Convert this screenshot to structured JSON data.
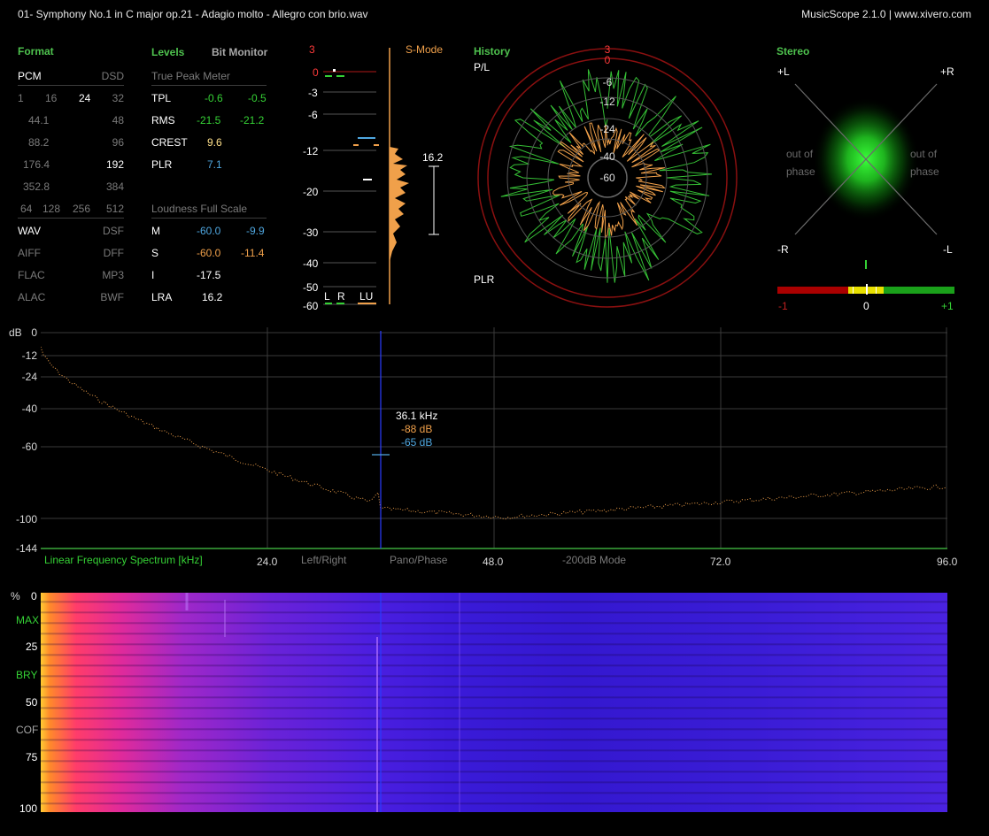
{
  "window": {
    "title": "01- Symphony No.1 in C major op.21 - Adagio molto - Allegro con brio.wav",
    "app": "MusicScope 2.1.0 | www.xivero.com"
  },
  "format": {
    "header": "Format",
    "pcm": "PCM",
    "dsd": "DSD",
    "bits": [
      "1",
      "16",
      "24",
      "32"
    ],
    "rates": [
      [
        "44.1",
        "48"
      ],
      [
        "88.2",
        "96"
      ],
      [
        "176.4",
        "192"
      ],
      [
        "352.8",
        "384"
      ]
    ],
    "dsd_rates": [
      "64",
      "128",
      "256",
      "512"
    ],
    "containers": [
      [
        "WAV",
        "DSF"
      ],
      [
        "AIFF",
        "DFF"
      ],
      [
        "FLAC",
        "MP3"
      ],
      [
        "ALAC",
        "BWF"
      ]
    ]
  },
  "levels": {
    "header": "Levels",
    "bit_monitor": "Bit Monitor",
    "true_peak_label": "True Peak Meter",
    "tpl": {
      "label": "TPL",
      "l": "-0.6",
      "r": "-0.5"
    },
    "rms": {
      "label": "RMS",
      "l": "-21.5",
      "r": "-21.2"
    },
    "crest": {
      "label": "CREST",
      "v": "9.6"
    },
    "plr": {
      "label": "PLR",
      "v": "7.1"
    },
    "loudness_label": "Loudness Full Scale",
    "m": {
      "label": "M",
      "a": "-60.0",
      "b": "-9.9"
    },
    "s": {
      "label": "S",
      "a": "-60.0",
      "b": "-11.4"
    },
    "i": {
      "label": "I",
      "v": "-17.5"
    },
    "lra": {
      "label": "LRA",
      "v": "16.2"
    }
  },
  "meter": {
    "smode": "S-Mode",
    "scale": [
      "3",
      "0",
      "-3",
      "-6",
      "-12",
      "-20",
      "-30",
      "-40",
      "-50",
      "-60"
    ],
    "lra_value": "16.2",
    "labels": {
      "l": "L",
      "r": "R",
      "lu": "LU"
    }
  },
  "history": {
    "header": "History",
    "pl": "P/L",
    "plr": "PLR",
    "rings": [
      "3",
      "0",
      "-6",
      "-12",
      "-24",
      "-40",
      "-60"
    ]
  },
  "stereo": {
    "header": "Stereo",
    "tl": "+L",
    "tr": "+R",
    "bl": "-R",
    "br": "-L",
    "oop_left": "out of phase",
    "oop_right": "out of phase",
    "corr": {
      "min": "-1",
      "zero": "0",
      "max": "+1"
    }
  },
  "spectrum": {
    "y_unit": "dB",
    "y_ticks": [
      "0",
      "-12",
      "-24",
      "-40",
      "-60",
      "-100",
      "-144"
    ],
    "x_ticks": [
      "24.0",
      "48.0",
      "72.0",
      "96.0"
    ],
    "title": "Linear Frequency Spectrum [kHz]",
    "modes": [
      "Left/Right",
      "Pano/Phase",
      "-200dB Mode"
    ],
    "cursor": {
      "freq": "36.1 kHz",
      "l": "-88 dB",
      "r": "-65 dB"
    }
  },
  "spectrogram": {
    "y_ticks": [
      "%",
      "0",
      "25",
      "50",
      "75",
      "100"
    ],
    "modes": [
      "MAX",
      "BRY",
      "COF"
    ]
  },
  "colors": {
    "accent_green": "#4ec24e",
    "orange": "#f0a04a",
    "cyan": "#4fa7e0",
    "cursor_blue": "#2a3cff",
    "ring_red": "#8a1010"
  }
}
